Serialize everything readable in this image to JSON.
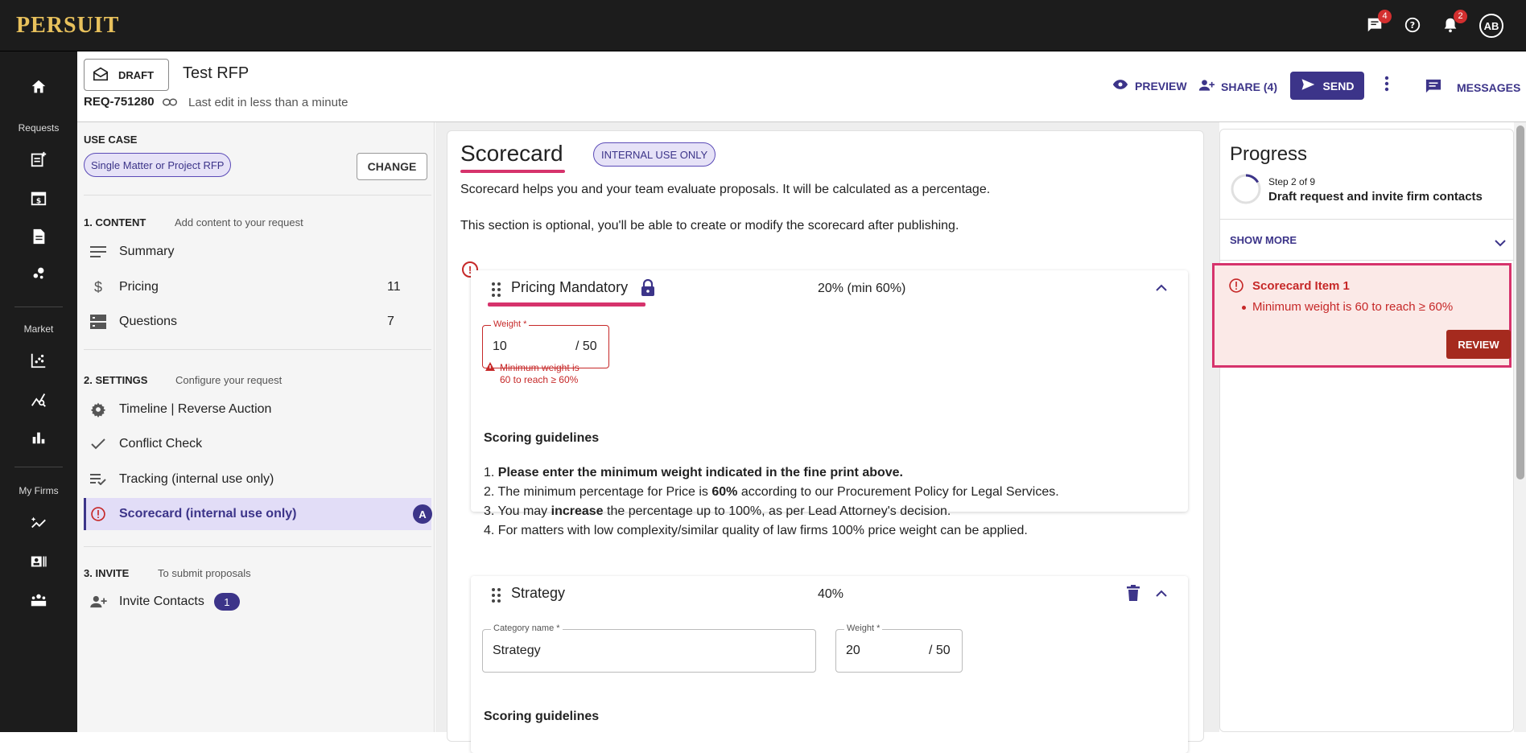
{
  "topbar": {
    "logo": "PERSUIT",
    "messages_badge": "4",
    "notifications_badge": "2",
    "avatar_initials": "AB"
  },
  "leftnav": {
    "requests_label": "Requests",
    "market_label": "Market",
    "my_firms_label": "My Firms"
  },
  "header": {
    "status_label": "DRAFT",
    "title": "Test RFP",
    "req_id": "REQ-751280",
    "last_edit": "Last edit in less than a minute",
    "preview_label": "PREVIEW",
    "share_label": "SHARE (4)",
    "send_label": "SEND",
    "messages_label": "MESSAGES"
  },
  "sidebar": {
    "use_case_heading": "USE CASE",
    "use_case_value": "Single Matter or Project RFP",
    "change_label": "CHANGE",
    "content_heading": "1. CONTENT",
    "content_sub": "Add content to your request",
    "content_items": [
      {
        "label": "Summary",
        "count": ""
      },
      {
        "label": "Pricing",
        "count": "11"
      },
      {
        "label": "Questions",
        "count": "7"
      }
    ],
    "settings_heading": "2. SETTINGS",
    "settings_sub": "Configure your request",
    "settings_items": [
      {
        "label": "Timeline | Reverse Auction"
      },
      {
        "label": "Conflict Check"
      },
      {
        "label": "Tracking (internal use only)"
      },
      {
        "label": "Scorecard (internal use only)",
        "badge": "A"
      }
    ],
    "invite_heading": "3. INVITE",
    "invite_sub": "To submit proposals",
    "invite_item": {
      "label": "Invite Contacts",
      "badge": "1"
    }
  },
  "main": {
    "title": "Scorecard",
    "chip": "INTERNAL USE ONLY",
    "desc1": "Scorecard helps you and your team evaluate proposals. It will be calculated as a percentage.",
    "desc2": "This section is optional, you'll be able to create or modify the scorecard after publishing.",
    "pricing": {
      "title": "Pricing Mandatory",
      "percent": "20% (min 60%)",
      "weight_label": "Weight *",
      "weight_value": "10",
      "weight_max": "/ 50",
      "error_line1": "Minimum weight is",
      "error_line2": "60 to reach ≥ 60%",
      "guidelines_heading": "Scoring guidelines",
      "g1": "Please enter the minimum weight indicated in the fine print above.",
      "g2_pre": "The minimum percentage for Price is ",
      "g2_bold": "60%",
      "g2_post": " according to our Procurement Policy for Legal Services.",
      "g3_pre": "You may ",
      "g3_bold": "increase",
      "g3_post": " the percentage up to 100%, as per Lead Attorney's decision.",
      "g4": "For matters with low complexity/similar quality of law firms 100% price weight can be applied."
    },
    "strategy": {
      "title": "Strategy",
      "percent": "40%",
      "category_label": "Category name *",
      "category_value": "Strategy",
      "weight_label": "Weight *",
      "weight_value": "20",
      "weight_max": "/ 50",
      "guidelines_heading": "Scoring guidelines"
    }
  },
  "progress": {
    "title": "Progress",
    "step": "Step 2 of 9",
    "step_desc": "Draft request and invite firm contacts",
    "show_more": "SHOW MORE",
    "alert_title": "Scorecard Item 1",
    "alert_item": "Minimum weight is 60 to reach ≥ 60%",
    "review_label": "REVIEW"
  },
  "colors": {
    "accent": "#3c3489",
    "error": "#c62828",
    "highlight": "#d6336c",
    "topbar": "#1c1c1c",
    "logo": "#e8c15c"
  }
}
